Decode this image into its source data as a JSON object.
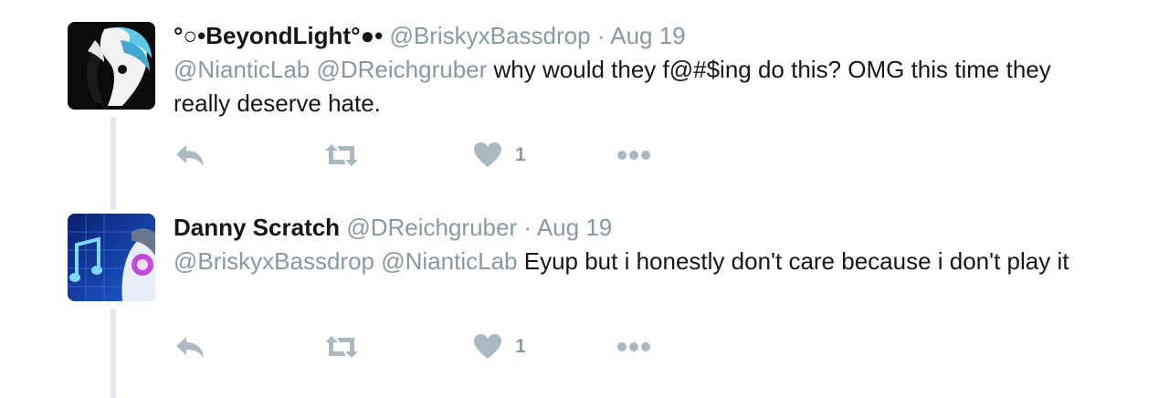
{
  "tweets": [
    {
      "fullname": "°○•BeyondLight°●•",
      "username": "@BriskyxBassdrop",
      "separator": "·",
      "time": "Aug 19",
      "mentions": [
        "@NianticLab",
        "@DReichgruber"
      ],
      "text": "why would they f@#$ing do this? OMG this time they really deserve hate.",
      "likes": "1",
      "icons": {
        "reply": "reply-icon",
        "retweet": "retweet-icon",
        "like": "heart-icon",
        "more": "more-dots-icon"
      }
    },
    {
      "fullname": "Danny Scratch",
      "username": "@DReichgruber",
      "separator": "·",
      "time": "Aug 19",
      "mentions": [
        "@BriskyxBassdrop",
        "@NianticLab"
      ],
      "text": "Eyup but i honestly don't care because i don't play it",
      "likes": "1",
      "icons": {
        "reply": "reply-icon",
        "retweet": "retweet-icon",
        "like": "heart-icon",
        "more": "more-dots-icon"
      }
    }
  ],
  "colors": {
    "secondary_text": "#8899a6",
    "primary_text": "#14171a",
    "icon": "#aab8c2",
    "thread_line": "#e1e8ed"
  }
}
